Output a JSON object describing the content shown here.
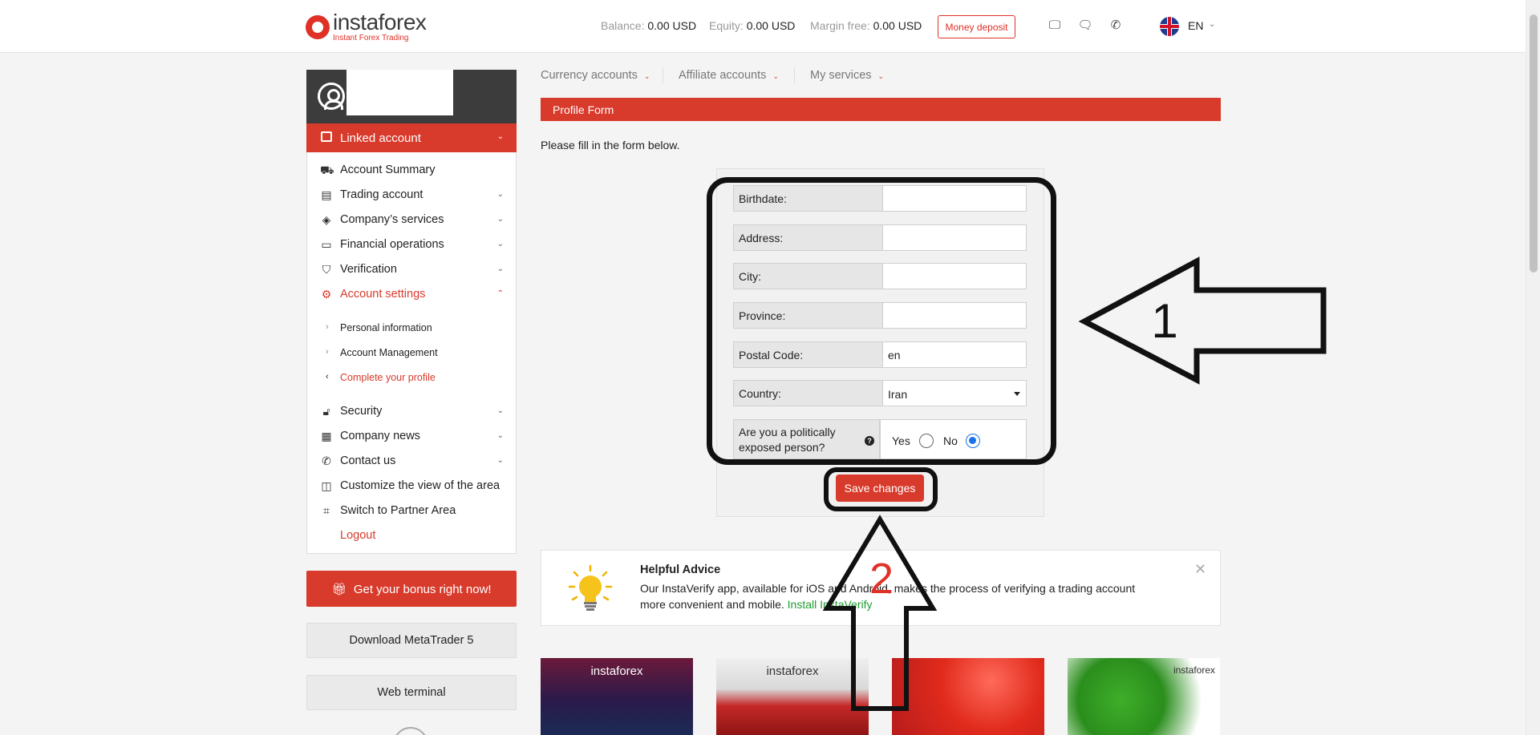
{
  "header": {
    "logo_name": "instaforex",
    "logo_tagline": "Instant Forex Trading",
    "balance_label": "Balance:",
    "balance_value": "0.00 USD",
    "equity_label": "Equity:",
    "equity_value": "0.00 USD",
    "margin_label": "Margin free:",
    "margin_value": "0.00 USD",
    "deposit_button": "Money deposit",
    "language": "EN",
    "icons": [
      "monitor-icon",
      "chat-icon",
      "phone-icon",
      "uk-flag-icon"
    ]
  },
  "sidebar": {
    "linked_account": "Linked account",
    "items": [
      {
        "label": "Account Summary",
        "icon": "briefcase-icon"
      },
      {
        "label": "Trading account",
        "icon": "ledger-icon"
      },
      {
        "label": "Company’s services",
        "icon": "layers-icon"
      },
      {
        "label": "Financial operations",
        "icon": "wallet-icon"
      },
      {
        "label": "Verification",
        "icon": "shield-icon"
      },
      {
        "label": "Account settings",
        "icon": "gear-icon"
      }
    ],
    "subitems": [
      {
        "label": "Personal information"
      },
      {
        "label": "Account Management"
      },
      {
        "label": "Complete your profile"
      }
    ],
    "items2": [
      {
        "label": "Security",
        "icon": "lock-icon"
      },
      {
        "label": "Company news",
        "icon": "news-icon"
      },
      {
        "label": "Contact us",
        "icon": "phone-icon"
      },
      {
        "label": "Customize the view of the area",
        "icon": "layout-icon"
      },
      {
        "label": "Switch to Partner Area",
        "icon": "frame-icon"
      },
      {
        "label": "Logout"
      }
    ],
    "bonus_button": "Get your bonus right now!",
    "metatrader_button": "Download MetaTrader 5",
    "web_terminal_button": "Web terminal"
  },
  "topnav": {
    "currency_accounts": "Currency accounts",
    "affiliate_accounts": "Affiliate accounts",
    "my_services": "My services"
  },
  "form": {
    "section_title": "Profile Form",
    "intro": "Please fill in the form below.",
    "birthdate_label": "Birthdate:",
    "birthdate_value": "",
    "address_label": "Address:",
    "address_value": "",
    "city_label": "City:",
    "city_value": "",
    "province_label": "Province:",
    "province_value": "",
    "postal_label": "Postal Code:",
    "postal_value": "en",
    "country_label": "Country:",
    "country_value": "Iran",
    "pep_label": "Are you a politically exposed person?",
    "pep_help": "?",
    "pep_yes": "Yes",
    "pep_no": "No",
    "pep_selected": "No",
    "save_button": "Save changes"
  },
  "annotations": {
    "arrow1_number": "1",
    "arrow2_number": "2"
  },
  "advice": {
    "title": "Helpful Advice",
    "text": "Our InstaVerify app, available for iOS and Android, makes the process of verifying a trading account more convenient and mobile.",
    "link": "Install InstaVerify",
    "close": "✕"
  },
  "tiles": [
    {
      "logo": "instaforex"
    },
    {
      "logo": "instaforex"
    },
    {
      "logo": ""
    },
    {
      "logo": "instaforex"
    }
  ],
  "colors": {
    "brand_red": "#d83a2b",
    "link_green": "#1e9d2f",
    "radio_blue": "#1a73e8"
  }
}
